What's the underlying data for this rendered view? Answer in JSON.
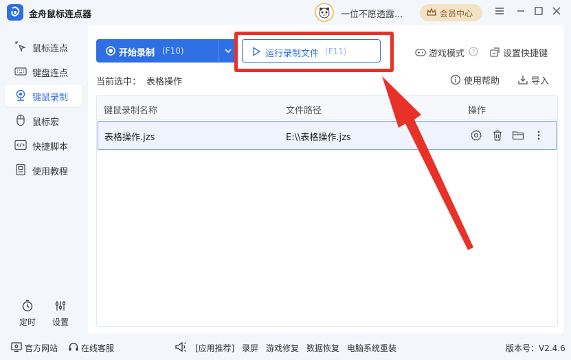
{
  "app": {
    "title": "金舟鼠标连点器",
    "accent": "#2f6fe4"
  },
  "user": {
    "name": "一位不愿透露...",
    "vip_label": "会员中心"
  },
  "sidebar": {
    "items": [
      {
        "label": "鼠标连点",
        "icon": "mouse-click-icon"
      },
      {
        "label": "键盘连点",
        "icon": "keyboard-icon"
      },
      {
        "label": "键鼠录制",
        "icon": "record-icon",
        "active": true
      },
      {
        "label": "鼠标宏",
        "icon": "mouse-icon"
      },
      {
        "label": "快捷脚本",
        "icon": "script-icon"
      },
      {
        "label": "使用教程",
        "icon": "tutorial-icon"
      }
    ],
    "bottom": [
      {
        "label": "定时",
        "icon": "timer-icon"
      },
      {
        "label": "设置",
        "icon": "settings-icon"
      }
    ]
  },
  "toolbar": {
    "start_label": "开始录制",
    "start_key": "(F10)",
    "run_label": "运行录制文件",
    "run_key": "(F11)",
    "game_mode": "游戏模式",
    "set_hotkey": "设置快捷键",
    "help": "使用帮助",
    "import": "导入"
  },
  "current": {
    "label": "当前选中：",
    "value": "表格操作"
  },
  "table": {
    "headers": [
      "键鼠录制名称",
      "文件路径",
      "操作"
    ],
    "rows": [
      {
        "name": "表格操作.jzs",
        "path": "E:\\\\表格操作.jzs",
        "actions": [
          "settings-icon",
          "delete-icon",
          "folder-icon",
          "more-icon"
        ]
      }
    ]
  },
  "footer": {
    "website": "官方网站",
    "support": "在线客服",
    "recommend": "[应用推荐]",
    "links": [
      "录屏",
      "游戏修复",
      "数据恢复",
      "电脑系统重装"
    ],
    "version": "版本号：V2.4.6"
  },
  "annotation": {
    "color": "#e83128"
  }
}
